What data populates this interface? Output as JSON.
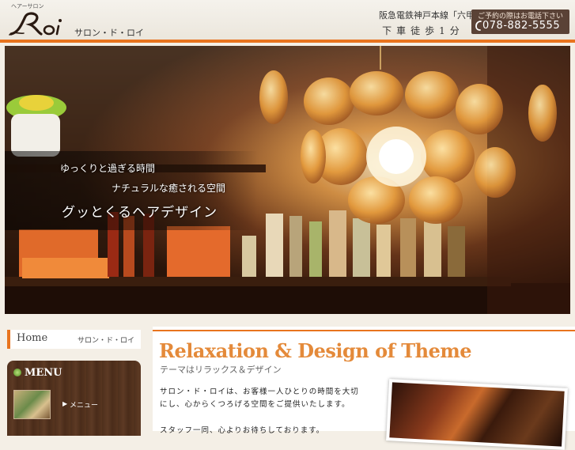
{
  "header": {
    "tagline": "ヘアーサロン",
    "logo_alt": "Roi",
    "logo_subtitle": "サロン・ド・ロイ",
    "access_line1": "阪急電鉄神戸本線「六甲」",
    "access_line2": "下車徒歩1分",
    "phone_note": "ご予約の際はお電話下さい",
    "phone_number": "078-882-5555"
  },
  "hero": {
    "caption_line1": "ゆっくりと過ぎる時間",
    "caption_line2": "ナチュラルな癒される空間",
    "caption_line3": "グッとくるヘアデザイン"
  },
  "breadcrumb": {
    "home": "Home",
    "current": "サロン・ド・ロイ"
  },
  "menu": {
    "heading": "MENU",
    "items": [
      {
        "label": "メニュー"
      }
    ]
  },
  "main": {
    "title": "Relaxation & Design of Theme",
    "subtitle": "テーマはリラックス＆デザイン",
    "paragraph1": "サロン・ド・ロイは、お客様一人ひとりの時間を大切にし、心からくつろげる空間をご提供いたします。",
    "paragraph2": "スタッフ一同、心よりお待ちしております。"
  },
  "colors": {
    "accent": "#e8741e",
    "title": "#e48a3a",
    "phone_box": "#5a4236",
    "menu_wood": "#4e2f1c"
  }
}
